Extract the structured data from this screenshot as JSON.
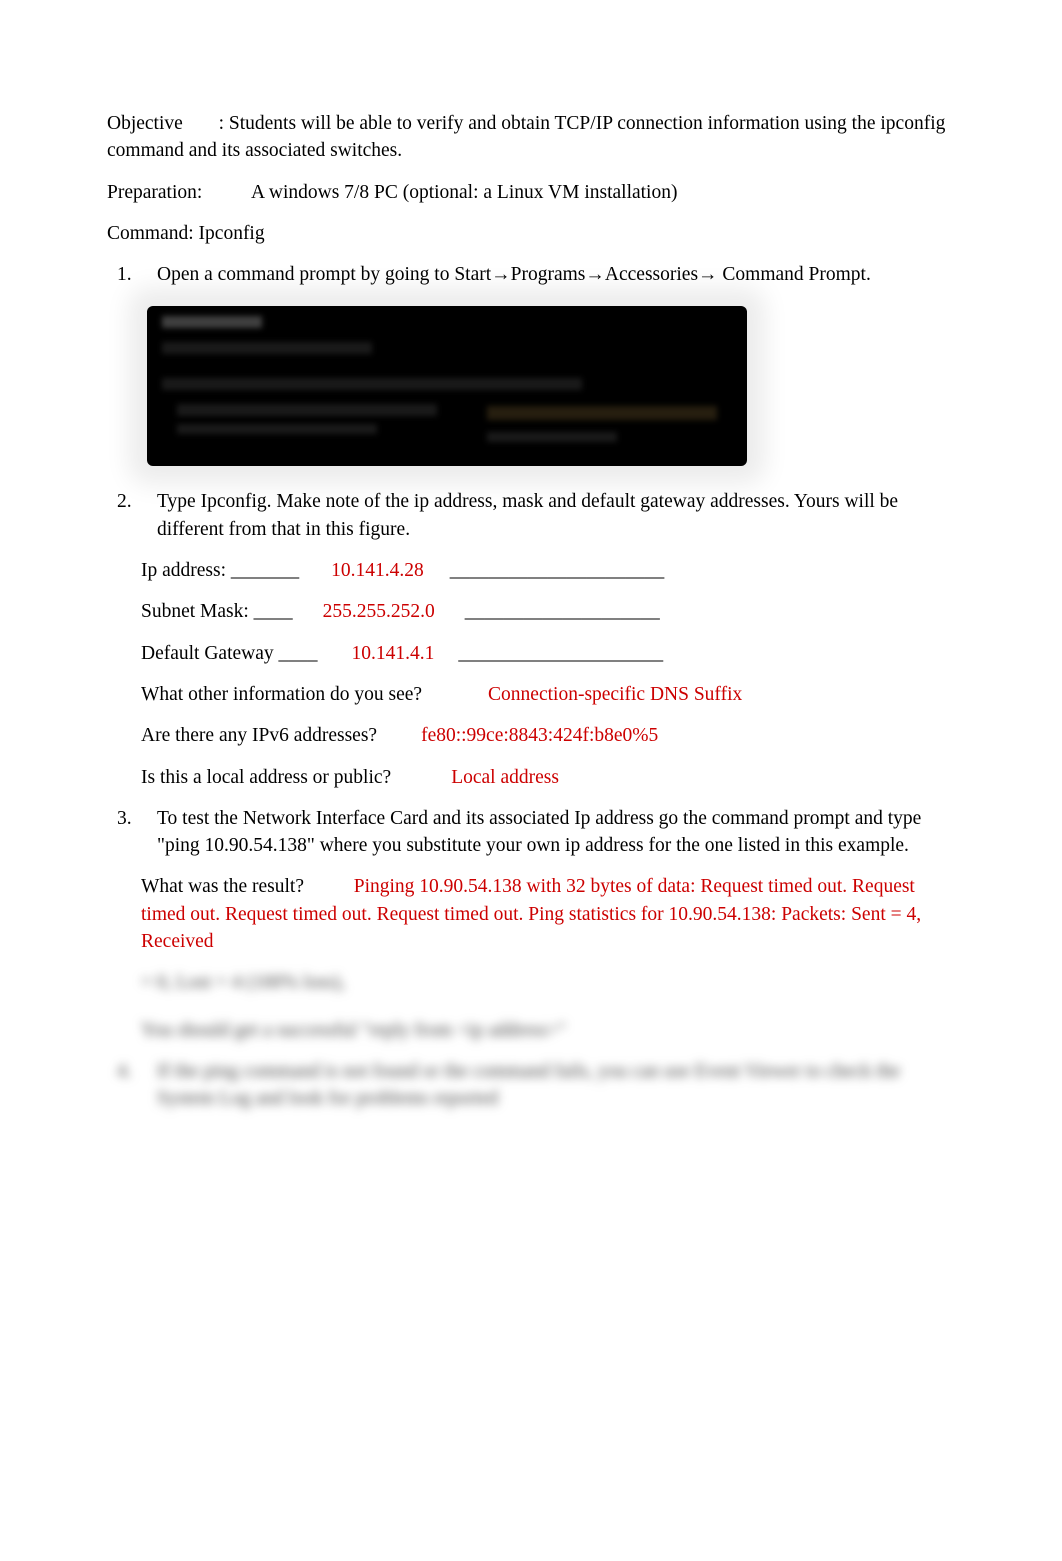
{
  "header": {
    "objective_label": "Objective",
    "objective_value": ": Students will be able to verify and obtain TCP/IP connection information using the ipconfig command and its associated switches.",
    "preparation_label": "Preparation:",
    "preparation_value": "A windows 7/8 PC (optional: a Linux VM installation)",
    "command_label": "Command: Ipconfig"
  },
  "steps": {
    "s1_num": "1.",
    "s1_text": "Open a command prompt by going to Start→Programs→Accessories→ Command Prompt.",
    "s2_num": "2.",
    "s2_text": "Type Ipconfig. Make note of the ip address, mask and default gateway addresses. Yours will be different from that in this figure.",
    "s3_num": "3.",
    "s3_text": "To test the Network Interface Card and its associated Ip address go the command prompt and type \"ping 10.90.54.138\" where you substitute your own ip address for the one listed in this example.",
    "s4_num": "4.",
    "s4_text": "If the ping command is not found or the command fails, you can use Event Viewer to check the System Log and look for problems reported"
  },
  "answers": {
    "ip_label": "Ip address: _______",
    "ip_value": "10.141.4.28",
    "ip_tail": "______________________",
    "mask_label": "Subnet Mask: ____",
    "mask_value": "255.255.252.0",
    "mask_tail": "____________________",
    "gw_label": "Default Gateway ____",
    "gw_value": "10.141.4.1",
    "gw_tail": "_____________________",
    "other_q": "What other information do you see?",
    "other_a": "Connection-specific DNS Suffix",
    "ipv6_q": "Are there any IPv6 addresses?",
    "ipv6_a": "fe80::99ce:8843:424f:b8e0%5",
    "local_q": "Is this a local address or public?",
    "local_a": "Local address",
    "result_q": "What was the result?",
    "result_a1": "Pinging 10.90.54.138 with 32 bytes of data: Request timed out. Request timed out. Request timed out. Request timed out. Ping statistics for 10.90.54.138: Packets: Sent = 4, Received ",
    "result_a2": "= 0, Lost = 4 (100% loss),",
    "reply_note": "You should get a successful \"reply from <ip address>\""
  }
}
